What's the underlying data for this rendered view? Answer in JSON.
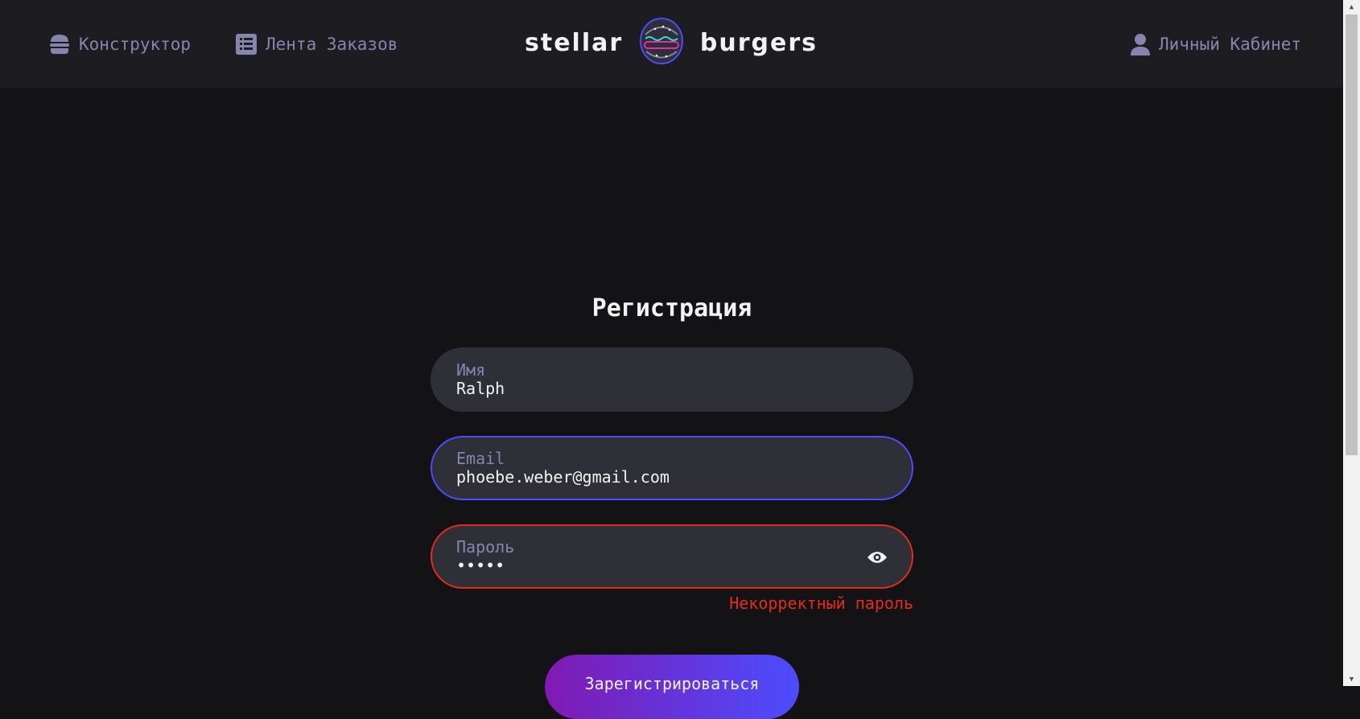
{
  "header": {
    "nav_constructor": "Конструктор",
    "nav_feed": "Лента Заказов",
    "nav_profile": "Личный Кабинет",
    "logo_left": "stellar",
    "logo_right": "burgers"
  },
  "icons": {
    "constructor": "burger-icon",
    "feed": "list-icon",
    "profile": "user-icon",
    "password_toggle": "eye-icon"
  },
  "form": {
    "title": "Регистрация",
    "name": {
      "label": "Имя",
      "value": "Ralph"
    },
    "email": {
      "label": "Email",
      "value": "phoebe.weber@gmail.com"
    },
    "password": {
      "label": "Пароль",
      "value": "•••••",
      "error": "Некорректный пароль"
    },
    "submit_label": "Зарегистрироваться"
  },
  "colors": {
    "background": "#131316",
    "header": "#1c1c21",
    "input": "#2f2f37",
    "muted_text": "#8585ad",
    "focus_border": "#4c4cff",
    "error": "#e52b1a",
    "button_gradient_start": "#801ab2",
    "button_gradient_end": "#4c4cff"
  }
}
